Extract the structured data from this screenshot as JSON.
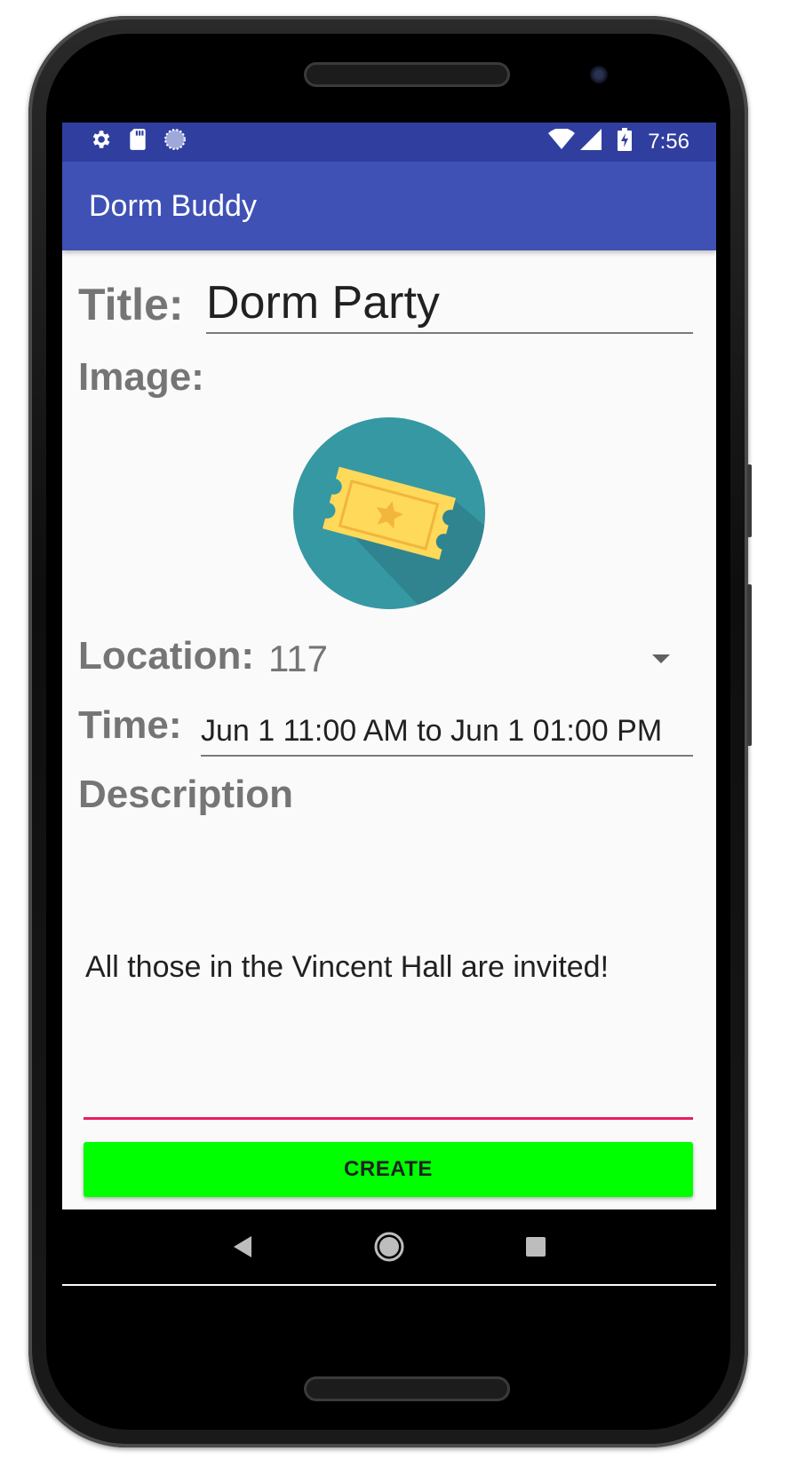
{
  "status_bar": {
    "time": "7:56",
    "left_icons": [
      "settings-icon",
      "sd-card-icon",
      "sync-icon"
    ],
    "right_icons": [
      "wifi-icon",
      "signal-icon",
      "battery-charging-icon"
    ]
  },
  "app_bar": {
    "title": "Dorm Buddy"
  },
  "form": {
    "title_label": "Title:",
    "title_value": "Dorm Party",
    "image_label": "Image:",
    "image_icon": "ticket-icon",
    "location_label": "Location:",
    "location_value": "117",
    "time_label": "Time:",
    "time_value": "Jun 1 11:00 AM to Jun 1 01:00 PM",
    "description_label": "Description",
    "description_value": "All those in the Vincent Hall are invited!",
    "create_label": "CREATE"
  },
  "nav_bar": {
    "icons": [
      "back-icon",
      "home-icon",
      "recents-icon"
    ]
  },
  "colors": {
    "status_bar": "#303f9f",
    "app_bar": "#3f51b5",
    "create_button": "#00ff00",
    "description_underline": "#e91e63",
    "ticket_circle": "#3698a3",
    "ticket_body": "#ffd95a"
  }
}
